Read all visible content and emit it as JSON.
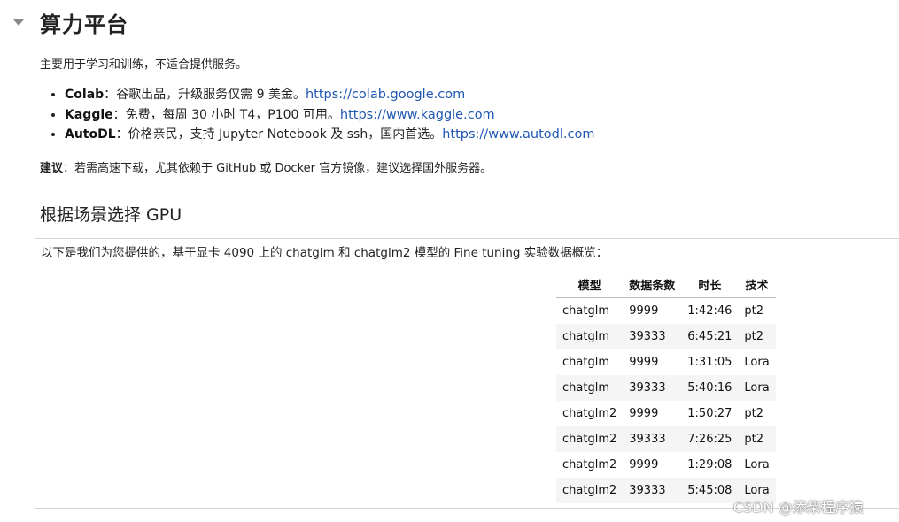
{
  "title": "算力平台",
  "intro": "主要用于学习和训练，不适合提供服务。",
  "platforms": [
    {
      "name": "Colab",
      "desc": "：谷歌出品，升级服务仅需 9 美金。",
      "url": "https://colab.google.com"
    },
    {
      "name": "Kaggle",
      "desc": "：免费，每周 30 小时 T4，P100 可用。",
      "url": "https://www.kaggle.com"
    },
    {
      "name": "AutoDL",
      "desc": "：价格亲民，支持 Jupyter Notebook 及 ssh，国内首选。",
      "url": "https://www.autodl.com"
    }
  ],
  "advice": {
    "label": "建议",
    "text": "：若需高速下载，尤其依赖于 GitHub 或 Docker 官方镜像，建议选择国外服务器。"
  },
  "section_heading": "根据场景选择 GPU",
  "output": {
    "description": "以下是我们为您提供的，基于显卡 4090 上的 chatglm 和 chatglm2 模型的 Fine tuning 实验数据概览：",
    "table": {
      "headers": [
        "模型",
        "数据条数",
        "时长",
        "技术"
      ],
      "rows": [
        [
          "chatglm",
          "9999",
          "1:42:46",
          "pt2"
        ],
        [
          "chatglm",
          "39333",
          "6:45:21",
          "pt2"
        ],
        [
          "chatglm",
          "9999",
          "1:31:05",
          "Lora"
        ],
        [
          "chatglm",
          "39333",
          "5:40:16",
          "Lora"
        ],
        [
          "chatglm2",
          "9999",
          "1:50:27",
          "pt2"
        ],
        [
          "chatglm2",
          "39333",
          "7:26:25",
          "pt2"
        ],
        [
          "chatglm2",
          "9999",
          "1:29:08",
          "Lora"
        ],
        [
          "chatglm2",
          "39333",
          "5:45:08",
          "Lora"
        ]
      ]
    }
  },
  "watermark": "CSDN @添柴程序猿"
}
